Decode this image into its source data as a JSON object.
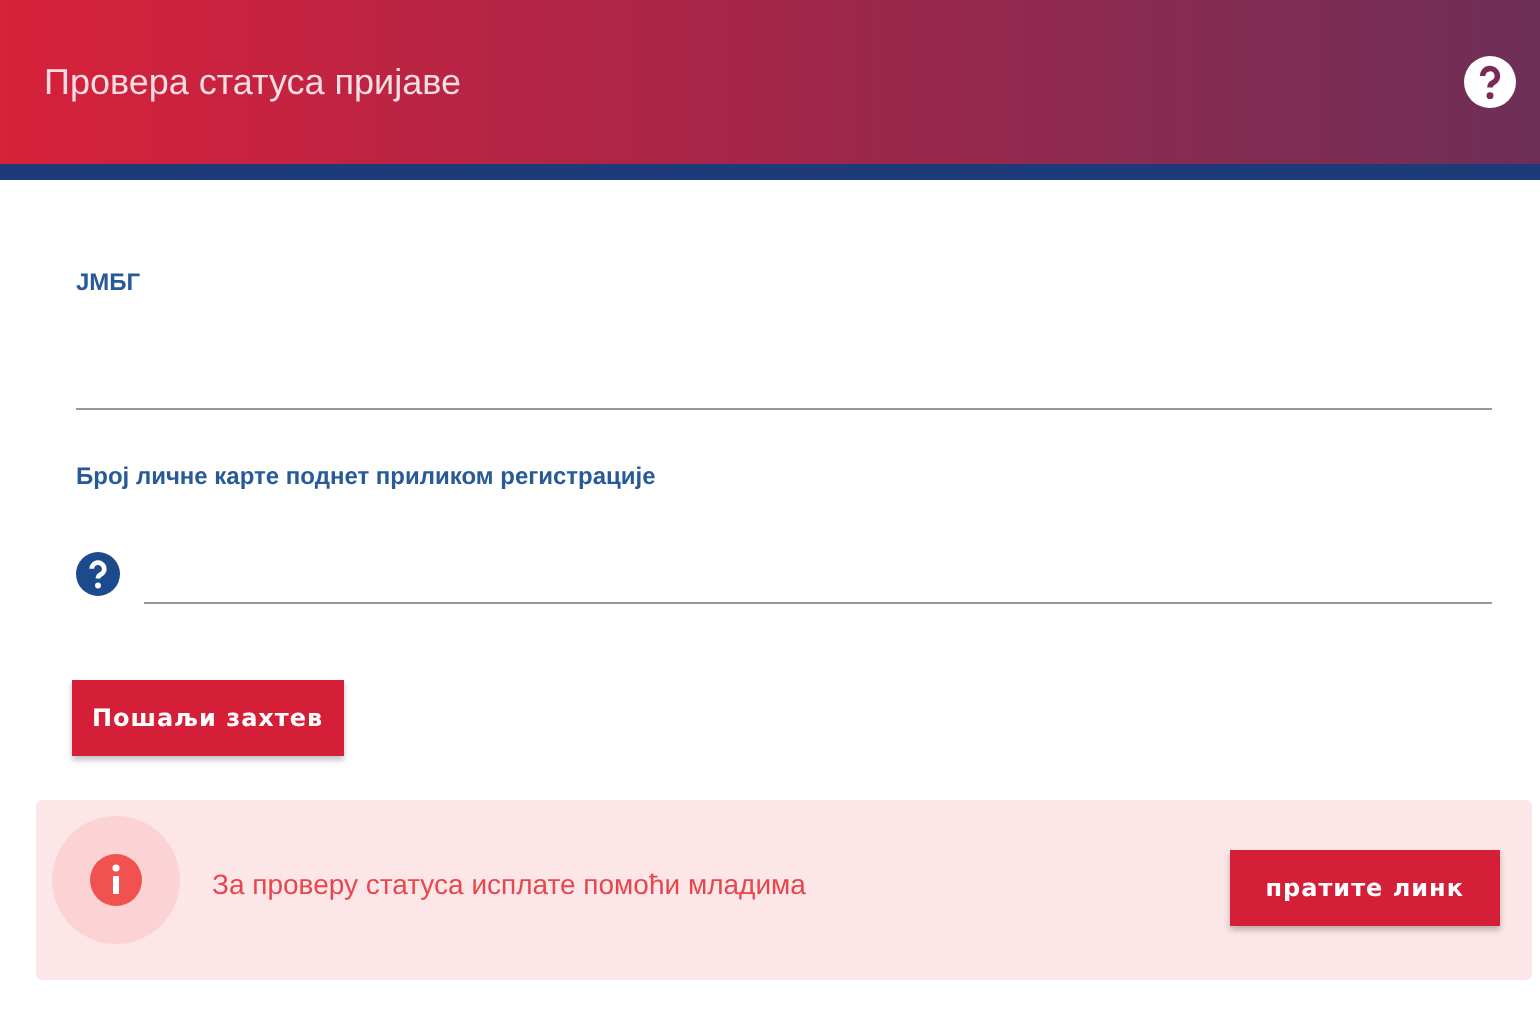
{
  "header": {
    "title": "Провера статуса пријаве"
  },
  "fields": [
    {
      "label": "ЈМБГ",
      "has_help": false
    },
    {
      "label": "Број личне карте поднет приликом регистрације",
      "has_help": true
    }
  ],
  "submit": {
    "label": "Пошаљи захтев"
  },
  "alert": {
    "text": "За проверу статуса исплате помоћи младима",
    "button": "пратите линк"
  }
}
